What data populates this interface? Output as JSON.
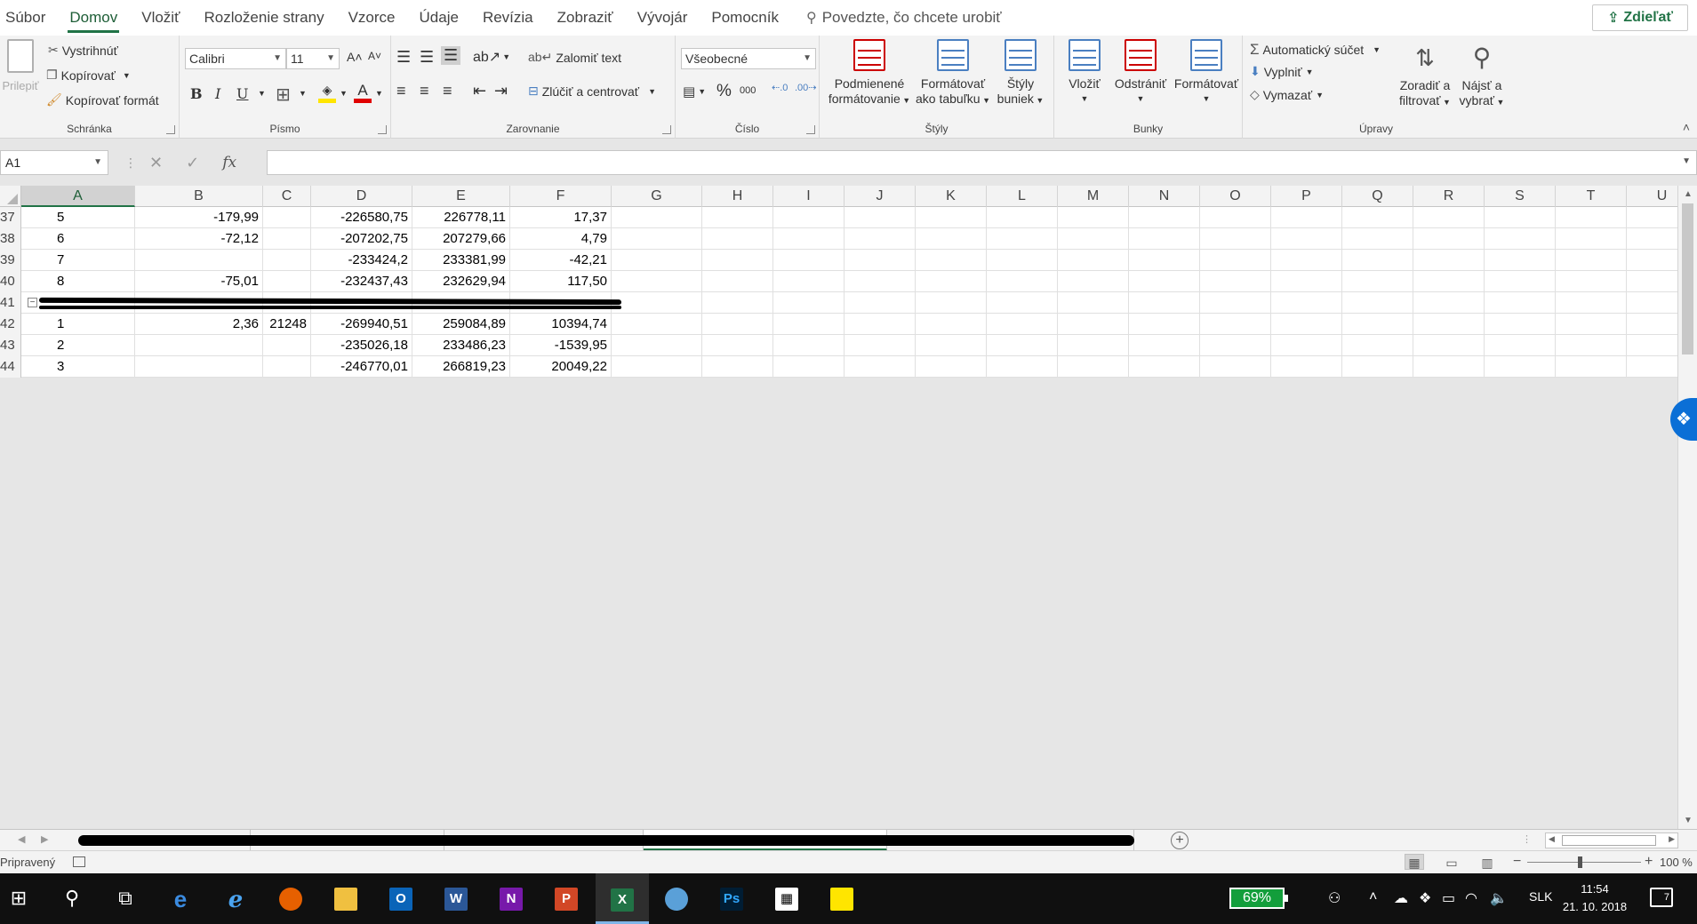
{
  "menu": {
    "tabs": [
      "Súbor",
      "Domov",
      "Vložiť",
      "Rozloženie strany",
      "Vzorce",
      "Údaje",
      "Revízia",
      "Zobraziť",
      "Vývojár",
      "Pomocník"
    ],
    "active_index": 1,
    "tell_me": "Povedzte, čo chcete urobiť",
    "share": "Zdieľať"
  },
  "ribbon": {
    "clipboard": {
      "paste": "Prilepiť",
      "cut": "Vystrihnúť",
      "copy": "Kopírovať",
      "format_painter": "Kopírovať formát",
      "label": "Schránka"
    },
    "font": {
      "name": "Calibri",
      "size": "11",
      "label": "Písmo",
      "bold": "B",
      "italic": "I",
      "underline": "U",
      "grow": "A˄",
      "shrink": "A˅"
    },
    "alignment": {
      "wrap": "Zalomiť text",
      "merge": "Zlúčiť a centrovať",
      "label": "Zarovnanie"
    },
    "number": {
      "format": "Všeobecné",
      "label": "Číslo",
      "percent": "%",
      "thousands": "000"
    },
    "styles": {
      "conditional": [
        "Podmienené",
        "formátovanie"
      ],
      "as_table": [
        "Formátovať",
        "ako tabuľku"
      ],
      "cell_styles": [
        "Štýly",
        "buniek"
      ],
      "label": "Štýly"
    },
    "cells": {
      "insert": "Vložiť",
      "delete": "Odstrániť",
      "format": "Formátovať",
      "label": "Bunky"
    },
    "editing": {
      "autosum": "Automatický súčet",
      "fill": "Vyplniť",
      "clear": "Vymazať",
      "sort": [
        "Zoradiť a",
        "filtrovať"
      ],
      "find": [
        "Nájsť a",
        "vybrať"
      ],
      "label": "Úpravy"
    }
  },
  "formula_bar": {
    "name_box": "A1",
    "fx": "fx",
    "value": ""
  },
  "grid": {
    "columns": [
      "A",
      "B",
      "C",
      "D",
      "E",
      "F",
      "G",
      "H",
      "I",
      "J",
      "K",
      "L",
      "M",
      "N",
      "O",
      "P",
      "Q",
      "R",
      "S",
      "T",
      "U"
    ],
    "active_column": "A",
    "rows": [
      {
        "num": "37",
        "a": "5",
        "b": "-179,99",
        "c": "",
        "d": "-226580,75",
        "e": "226778,11",
        "f": "17,37"
      },
      {
        "num": "38",
        "a": "6",
        "b": "-72,12",
        "c": "",
        "d": "-207202,75",
        "e": "207279,66",
        "f": "4,79"
      },
      {
        "num": "39",
        "a": "7",
        "b": "",
        "c": "",
        "d": "-233424,2",
        "e": "233381,99",
        "f": "-42,21"
      },
      {
        "num": "40",
        "a": "8",
        "b": "-75,01",
        "c": "",
        "d": "-232437,43",
        "e": "232629,94",
        "f": "117,50"
      },
      {
        "num": "41",
        "a": "",
        "b": "",
        "c": "",
        "d": "",
        "e": "",
        "f": ""
      },
      {
        "num": "42",
        "a": "1",
        "b": "2,36",
        "c": "21248",
        "d": "-269940,51",
        "e": "259084,89",
        "f": "10394,74"
      },
      {
        "num": "43",
        "a": "2",
        "b": "",
        "c": "",
        "d": "-235026,18",
        "e": "233486,23",
        "f": "-1539,95"
      },
      {
        "num": "44",
        "a": "3",
        "b": "",
        "c": "",
        "d": "-246770,01",
        "e": "266819,23",
        "f": "20049,22"
      }
    ]
  },
  "status": {
    "ready": "Pripravený",
    "zoom": "100 %"
  },
  "taskbar": {
    "battery": "69%",
    "language": "SLK",
    "time": "11:54",
    "date": "21. 10. 2018",
    "notifications": "7"
  }
}
